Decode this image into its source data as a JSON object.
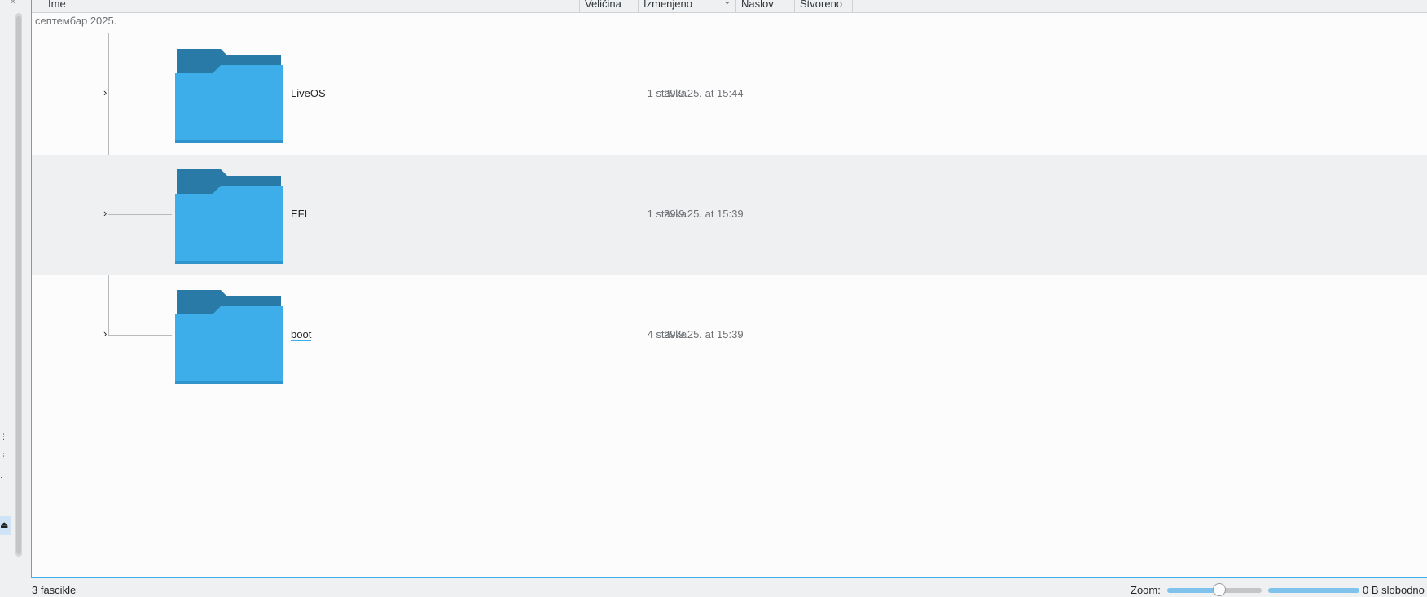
{
  "columns": {
    "name": "Ime",
    "size": "Veličina",
    "modified": "Izmenjeno",
    "title": "Naslov",
    "created": "Stvoreno"
  },
  "group_label": "септембар 2025.",
  "rows": [
    {
      "name": "LiveOS",
      "size": "1 stavka",
      "date": "29.9.25. at 15:44"
    },
    {
      "name": "EFI",
      "size": "1 stavka",
      "date": "29.9.25. at 15:39"
    },
    {
      "name": "boot",
      "size": "4 stavke",
      "date": "29.9.25. at 15:39"
    }
  ],
  "status": {
    "count": "3 fascikle",
    "zoom_label": "Zoom:",
    "zoom_level": 0.55,
    "free_space": "0 B slobodno",
    "space_used": 1.0
  },
  "colors": {
    "accent": "#3daee9",
    "folder_body": "#3daee9",
    "folder_tab": "#2a7aa8"
  },
  "icons": {
    "folder": "folder-icon",
    "expander": "chevron-right-icon",
    "sort": "chevron-down-icon"
  }
}
